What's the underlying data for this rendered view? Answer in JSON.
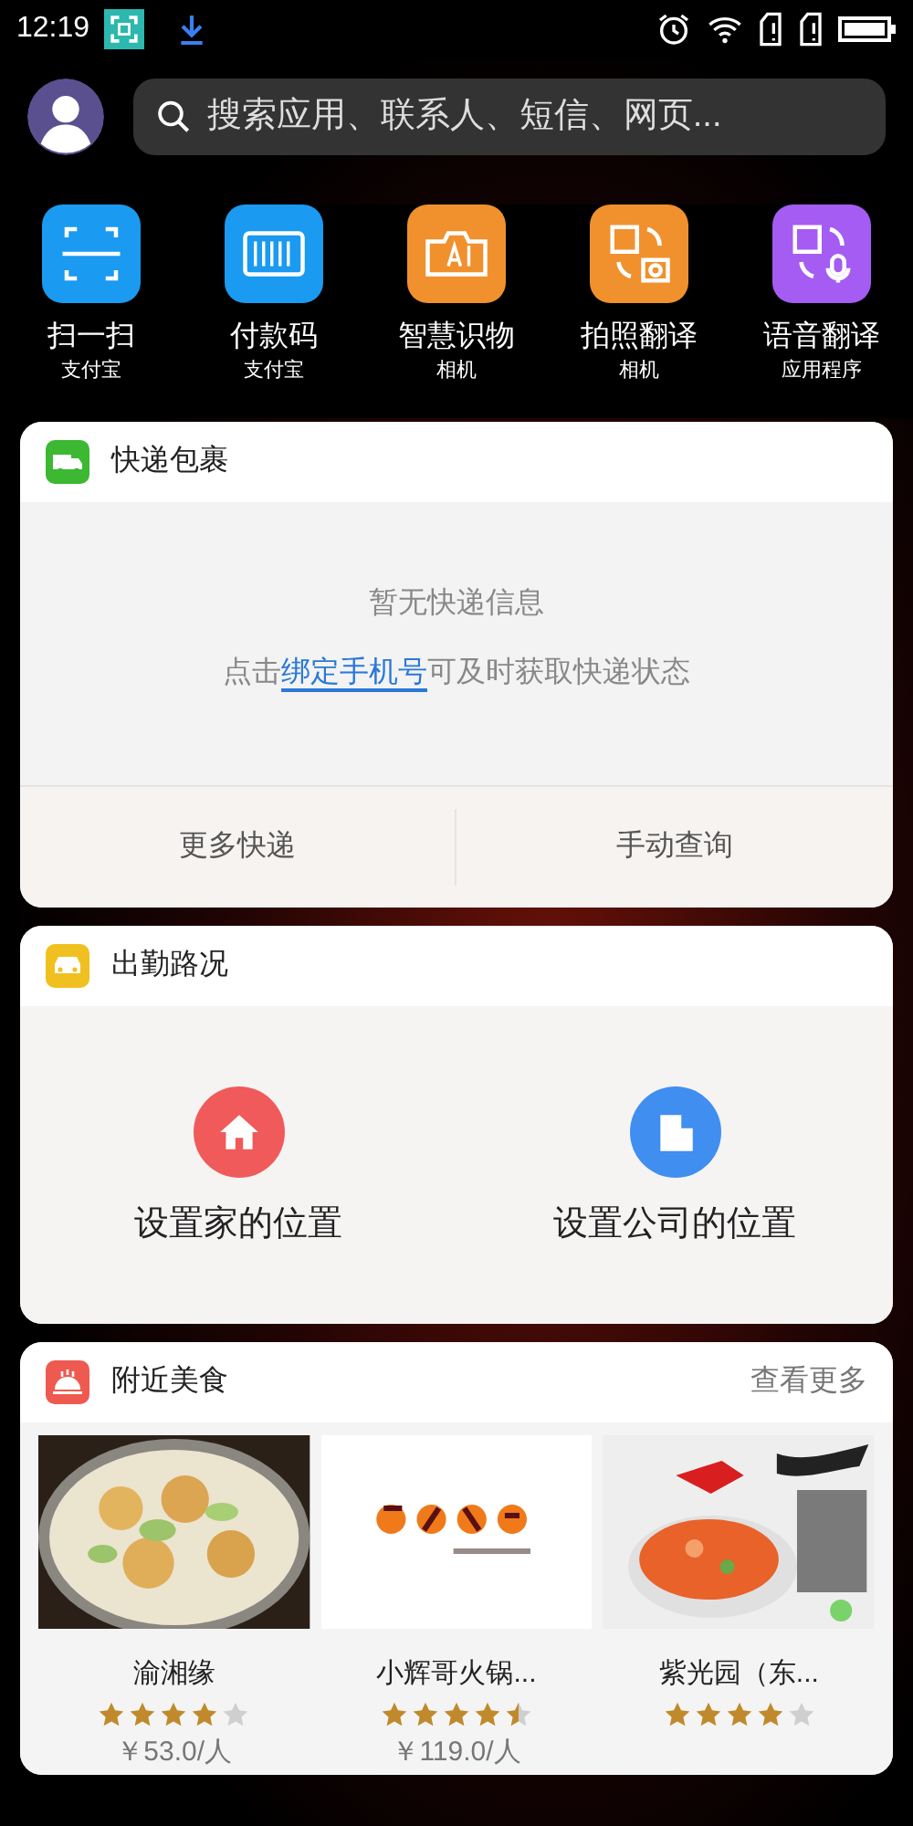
{
  "status_bar": {
    "time": "12:19"
  },
  "search": {
    "placeholder": "搜索应用、联系人、短信、网页..."
  },
  "shortcuts": [
    {
      "label": "扫一扫",
      "source": "支付宝",
      "kind": "scan",
      "color": "#1a9af0"
    },
    {
      "label": "付款码",
      "source": "支付宝",
      "kind": "barcode",
      "color": "#1a9af0"
    },
    {
      "label": "智慧识物",
      "source": "相机",
      "kind": "camera",
      "color": "#f0912e"
    },
    {
      "label": "拍照翻译",
      "source": "相机",
      "kind": "phototranslate",
      "color": "#f0912e"
    },
    {
      "label": "语音翻译",
      "source": "应用程序",
      "kind": "voicetranslate",
      "color": "#a55cf2"
    }
  ],
  "express": {
    "title": "快递包裹",
    "empty": "暂无快递信息",
    "hint_before": "点击",
    "hint_link": "绑定手机号",
    "hint_after": "可及时获取快递状态",
    "actions": [
      "更多快递",
      "手动查询"
    ]
  },
  "commute": {
    "title": "出勤路况",
    "places": [
      {
        "label": "设置家的位置",
        "kind": "home",
        "color": "#f05a5a"
      },
      {
        "label": "设置公司的位置",
        "kind": "office",
        "color": "#3f8ef0"
      }
    ]
  },
  "food": {
    "title": "附近美食",
    "more": "查看更多",
    "items": [
      {
        "name": "渝湘缘",
        "stars": 4,
        "price": "￥53.0/人"
      },
      {
        "name": "小辉哥火锅...",
        "stars": 4.5,
        "price": "￥119.0/人"
      },
      {
        "name": "紫光园（东...",
        "stars": 4
      }
    ]
  }
}
